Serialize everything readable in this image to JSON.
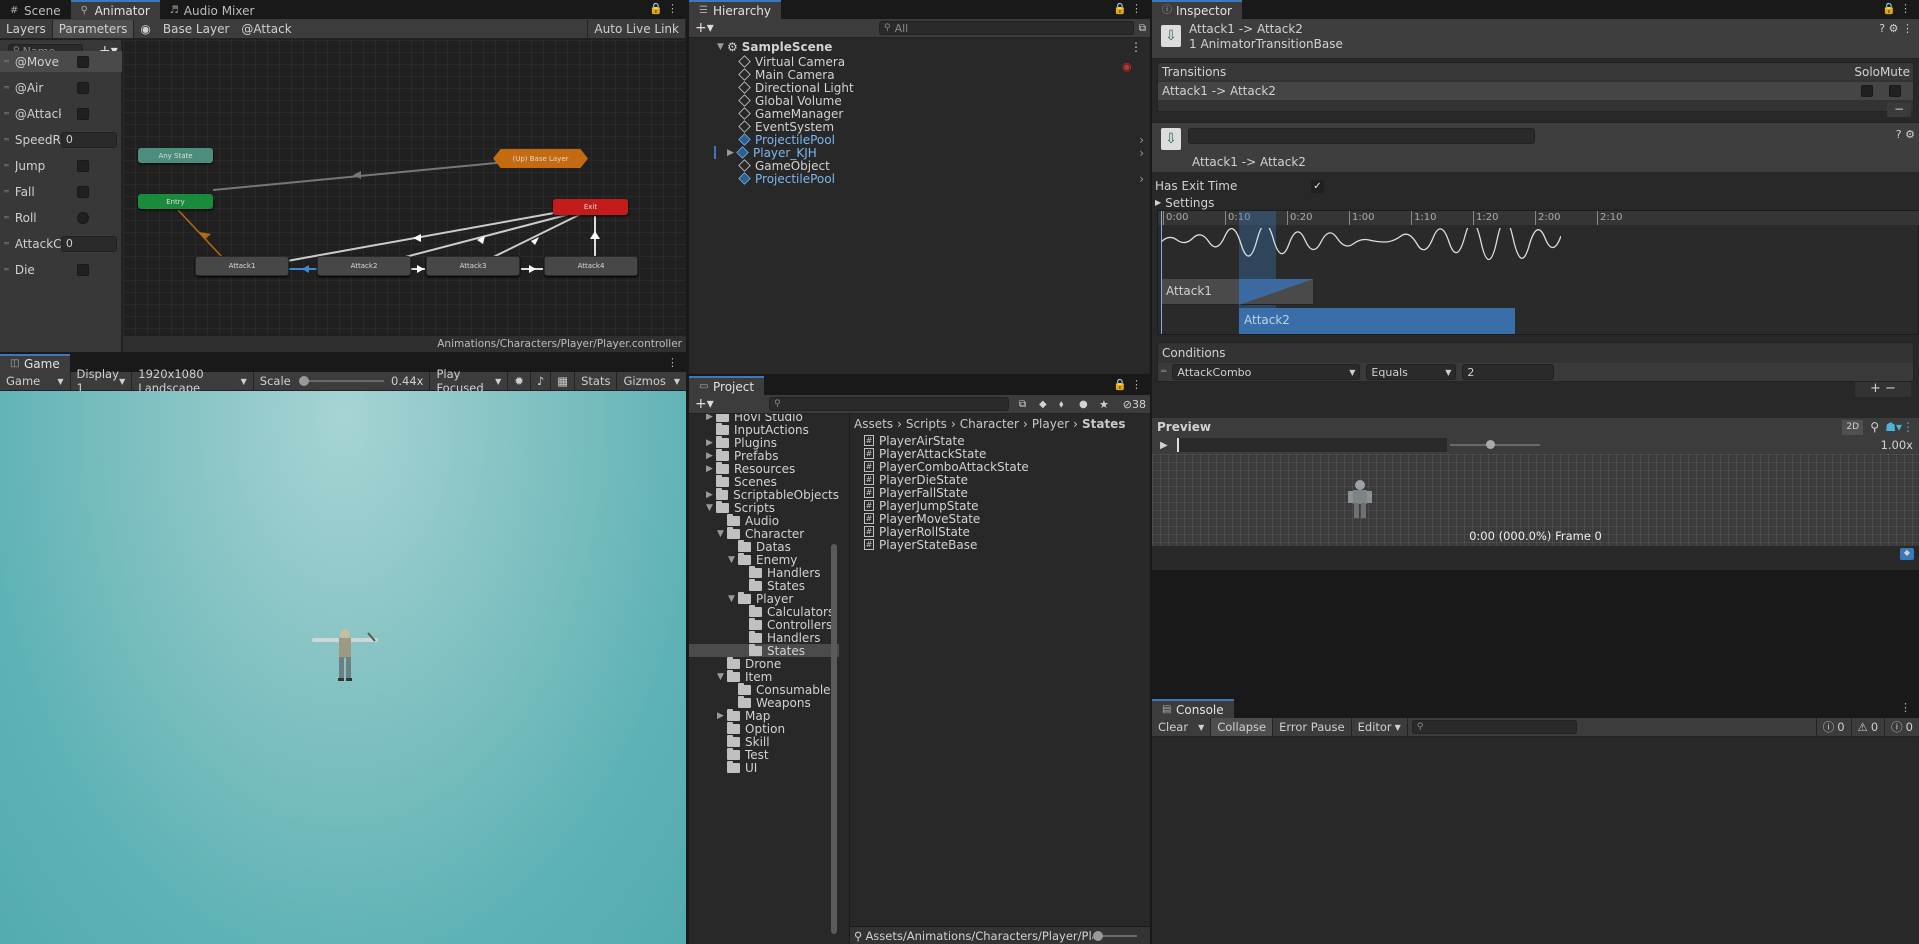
{
  "animator": {
    "tabs": [
      {
        "label": "Scene",
        "icon": "grid-icon"
      },
      {
        "label": "Animator",
        "icon": "animator-icon"
      },
      {
        "label": "Audio Mixer",
        "icon": "audio-icon"
      }
    ],
    "toolbar": {
      "layers": "Layers",
      "parameters": "Parameters",
      "base_layer": "Base Layer",
      "attack": "@Attack",
      "auto_live_link": "Auto Live Link"
    },
    "search_placeholder": "Name",
    "params": [
      {
        "name": "@Move",
        "type": "bool"
      },
      {
        "name": "@Air",
        "type": "bool"
      },
      {
        "name": "@Attack",
        "type": "bool"
      },
      {
        "name": "SpeedRa",
        "type": "float",
        "value": "0"
      },
      {
        "name": "Jump",
        "type": "bool"
      },
      {
        "name": "Fall",
        "type": "bool"
      },
      {
        "name": "Roll",
        "type": "trigger"
      },
      {
        "name": "AttackCo",
        "type": "int",
        "value": "0"
      },
      {
        "name": "Die",
        "type": "bool"
      }
    ],
    "nodes": {
      "any_state": "Any State",
      "up_base": "(Up) Base Layer",
      "entry": "Entry",
      "exit": "Exit",
      "attack1": "Attack1",
      "attack2": "Attack2",
      "attack3": "Attack3",
      "attack4": "Attack4"
    },
    "path": "Animations/Characters/Player/Player.controller"
  },
  "game": {
    "tab": "Game",
    "toolbar": {
      "mode": "Game",
      "display": "Display 1",
      "resolution": "1920x1080 Landscape",
      "scale_label": "Scale",
      "scale_value": "0.44x",
      "play_mode": "Play Focused",
      "stats": "Stats",
      "gizmos": "Gizmos"
    },
    "colors": {
      "sky_top": "#8fc6c6",
      "sky_bottom": "#4fa9ad"
    }
  },
  "hierarchy": {
    "tab": "Hierarchy",
    "search_placeholder": "All",
    "scene": "SampleScene",
    "items": [
      {
        "label": "Virtual Camera",
        "prefab": false
      },
      {
        "label": "Main Camera",
        "prefab": false
      },
      {
        "label": "Directional Light",
        "prefab": false
      },
      {
        "label": "Global Volume",
        "prefab": false
      },
      {
        "label": "GameManager",
        "prefab": false
      },
      {
        "label": "EventSystem",
        "prefab": false
      },
      {
        "label": "ProjectilePool",
        "prefab": true
      },
      {
        "label": "Player_KJH",
        "prefab": true
      },
      {
        "label": "GameObject",
        "prefab": false
      },
      {
        "label": "ProjectilePool",
        "prefab": true
      }
    ]
  },
  "project": {
    "tab": "Project",
    "hidden_count": "38",
    "folders": [
      {
        "label": "Hovl Studio",
        "depth": 1,
        "arrow": "right"
      },
      {
        "label": "InputActions",
        "depth": 1,
        "arrow": ""
      },
      {
        "label": "Plugins",
        "depth": 1,
        "arrow": "right"
      },
      {
        "label": "Prefabs",
        "depth": 1,
        "arrow": "right"
      },
      {
        "label": "Resources",
        "depth": 1,
        "arrow": "right"
      },
      {
        "label": "Scenes",
        "depth": 1,
        "arrow": ""
      },
      {
        "label": "ScriptableObjects",
        "depth": 1,
        "arrow": "right"
      },
      {
        "label": "Scripts",
        "depth": 1,
        "arrow": "down"
      },
      {
        "label": "Audio",
        "depth": 2,
        "arrow": ""
      },
      {
        "label": "Character",
        "depth": 2,
        "arrow": "down"
      },
      {
        "label": "Datas",
        "depth": 3,
        "arrow": ""
      },
      {
        "label": "Enemy",
        "depth": 3,
        "arrow": "down"
      },
      {
        "label": "Handlers",
        "depth": 4,
        "arrow": ""
      },
      {
        "label": "States",
        "depth": 4,
        "arrow": ""
      },
      {
        "label": "Player",
        "depth": 3,
        "arrow": "down"
      },
      {
        "label": "Calculators",
        "depth": 4,
        "arrow": ""
      },
      {
        "label": "Controllers",
        "depth": 4,
        "arrow": ""
      },
      {
        "label": "Handlers",
        "depth": 4,
        "arrow": ""
      },
      {
        "label": "States",
        "depth": 4,
        "arrow": "",
        "selected": true
      },
      {
        "label": "Drone",
        "depth": 2,
        "arrow": ""
      },
      {
        "label": "Item",
        "depth": 2,
        "arrow": "down"
      },
      {
        "label": "Consumable",
        "depth": 3,
        "arrow": ""
      },
      {
        "label": "Weapons",
        "depth": 3,
        "arrow": ""
      },
      {
        "label": "Map",
        "depth": 2,
        "arrow": "right"
      },
      {
        "label": "Option",
        "depth": 2,
        "arrow": ""
      },
      {
        "label": "Skill",
        "depth": 2,
        "arrow": ""
      },
      {
        "label": "Test",
        "depth": 2,
        "arrow": ""
      },
      {
        "label": "UI",
        "depth": 2,
        "arrow": ""
      }
    ],
    "breadcrumb": [
      "Assets",
      "Scripts",
      "Character",
      "Player",
      "States"
    ],
    "files": [
      "PlayerAirState",
      "PlayerAttackState",
      "PlayerComboAttackState",
      "PlayerDieState",
      "PlayerFallState",
      "PlayerJumpState",
      "PlayerMoveState",
      "PlayerRollState",
      "PlayerStateBase"
    ],
    "footer_path": "Assets/Animations/Characters/Player/Player.cont"
  },
  "inspector": {
    "tab": "Inspector",
    "title": "Attack1 -> Attack2",
    "subtitle": "1 AnimatorTransitionBase",
    "transitions_label": "Transitions",
    "solo": "Solo",
    "mute": "Mute",
    "transition_item": "Attack1 -> Attack2",
    "transition_name": "Attack1 -> Attack2",
    "has_exit_time": "Has Exit Time",
    "settings": "Settings",
    "timeline_ticks": [
      "0:00",
      "0:10",
      "0:20",
      "1:00",
      "1:10",
      "1:20",
      "2:00",
      "2:10"
    ],
    "clip1": "Attack1",
    "clip2": "Attack2",
    "conditions_label": "Conditions",
    "condition": {
      "param": "AttackCombo",
      "op": "Equals",
      "value": "2"
    },
    "preview": {
      "label": "Preview",
      "mode": "2D",
      "speed": "1.00x",
      "time": "0:00 (000.0%) Frame 0"
    }
  },
  "console": {
    "tab": "Console",
    "clear": "Clear",
    "collapse": "Collapse",
    "error_pause": "Error Pause",
    "editor": "Editor",
    "counts": {
      "log": "0",
      "warn": "0",
      "error": "0"
    }
  }
}
